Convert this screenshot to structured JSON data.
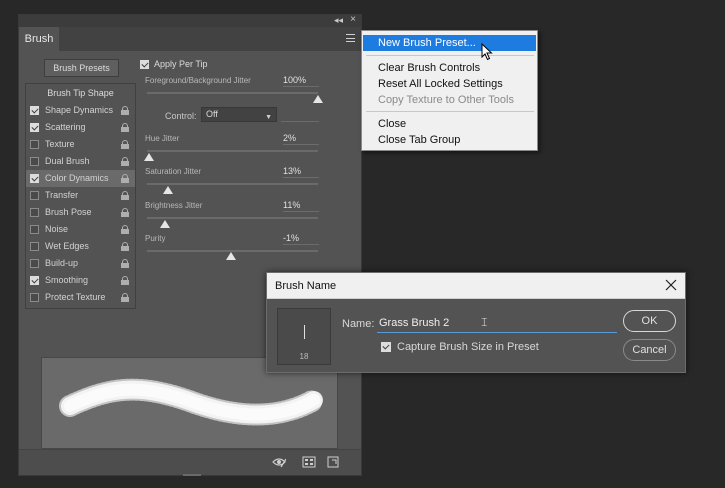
{
  "panel": {
    "tab_label": "Brush",
    "presets_button": "Brush Presets",
    "list_header": "Brush Tip Shape",
    "items": [
      {
        "label": "Shape Dynamics",
        "checked": true
      },
      {
        "label": "Scattering",
        "checked": true
      },
      {
        "label": "Texture",
        "checked": false
      },
      {
        "label": "Dual Brush",
        "checked": false
      },
      {
        "label": "Color Dynamics",
        "checked": true,
        "selected": true
      },
      {
        "label": "Transfer",
        "checked": false
      },
      {
        "label": "Brush Pose",
        "checked": false
      },
      {
        "label": "Noise",
        "checked": false
      },
      {
        "label": "Wet Edges",
        "checked": false
      },
      {
        "label": "Build-up",
        "checked": false
      },
      {
        "label": "Smoothing",
        "checked": true
      },
      {
        "label": "Protect Texture",
        "checked": false
      }
    ],
    "apply_per_tip": "Apply Per Tip",
    "fg_bg_jitter": {
      "label": "Foreground/Background Jitter",
      "value": "100%"
    },
    "control": {
      "label": "Control:",
      "value": "Off"
    },
    "hue_jitter": {
      "label": "Hue Jitter",
      "value": "2%"
    },
    "saturation_jitter": {
      "label": "Saturation Jitter",
      "value": "13%"
    },
    "brightness_jitter": {
      "label": "Brightness Jitter",
      "value": "11%"
    },
    "purity": {
      "label": "Purity",
      "value": "-1%"
    }
  },
  "menu": {
    "items": [
      {
        "label": "New Brush Preset...",
        "state": "highlighted"
      },
      {
        "label": "Clear Brush Controls",
        "state": "normal"
      },
      {
        "label": "Reset All Locked Settings",
        "state": "normal"
      },
      {
        "label": "Copy Texture to Other Tools",
        "state": "disabled"
      },
      {
        "label": "Close",
        "state": "normal"
      },
      {
        "label": "Close Tab Group",
        "state": "normal"
      }
    ]
  },
  "dialog": {
    "title": "Brush Name",
    "brush_size": "18",
    "name_label": "Name:",
    "name_value": "Grass Brush 2",
    "capture_label": "Capture Brush Size in Preset",
    "ok": "OK",
    "cancel": "Cancel"
  },
  "colors": {
    "menu_highlight": "#1e7be0",
    "panel_bg": "#535353",
    "workspace_bg": "#282828"
  }
}
